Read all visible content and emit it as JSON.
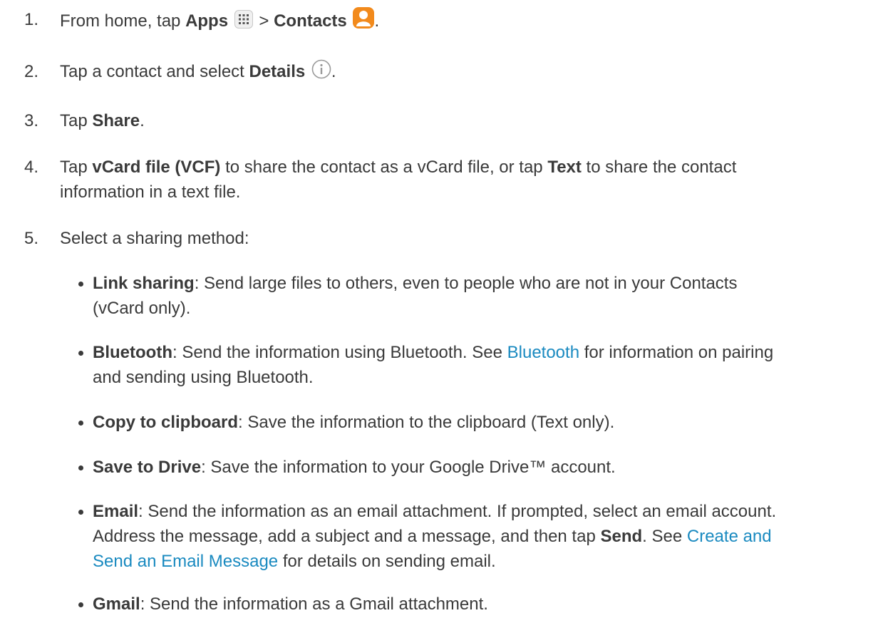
{
  "steps": [
    {
      "number": "1.",
      "parts": {
        "t1": "From home, tap ",
        "b1": "Apps",
        "t2": " > ",
        "b2": "Contacts",
        "t3": "."
      },
      "icons": [
        "apps-grid-icon",
        "contacts-app-icon"
      ]
    },
    {
      "number": "2.",
      "parts": {
        "t1": "Tap a contact and select ",
        "b1": "Details",
        "t2": "."
      },
      "icons": [
        "info-circle-icon"
      ]
    },
    {
      "number": "3.",
      "parts": {
        "t1": "Tap ",
        "b1": "Share",
        "t2": "."
      }
    },
    {
      "number": "4.",
      "parts": {
        "t1": "Tap ",
        "b1": "vCard file (VCF)",
        "t2": " to share the contact as a vCard file, or tap ",
        "b2": "Text",
        "t3": " to share the contact",
        "t4": "information in a text file."
      }
    },
    {
      "number": "5.",
      "parts": {
        "t1": "Select a sharing method:"
      }
    }
  ],
  "bullets": [
    {
      "b1": "Link sharing",
      "t1": ": Send large files to others, even to people who are not in your Contacts",
      "t2": "(vCard only)."
    },
    {
      "b1": "Bluetooth",
      "t1": ": Send the information using Bluetooth. See ",
      "link1": "Bluetooth",
      "t2": " for information on pairing",
      "t3": "and sending using Bluetooth."
    },
    {
      "b1": "Copy to clipboard",
      "t1": ": Save the information to the clipboard (Text only)."
    },
    {
      "b1": "Save to Drive",
      "t1": ": Save the information to your Google Drive™ account."
    },
    {
      "b1": "Email",
      "t1": ": Send the information as an email attachment. If prompted, select an email account.",
      "t2": "Address the message, add a subject and a message, and then tap ",
      "b2": "Send",
      "t3": ". See ",
      "link1": "Create and",
      "link2": "Send an Email Message",
      "t4": " for details on sending email."
    },
    {
      "b1": "Gmail",
      "t1": ": Send the information as a Gmail attachment."
    }
  ],
  "colors": {
    "text": "#3a3a3a",
    "link": "#1a8ac0",
    "contacts_icon": "#f28a1c"
  }
}
